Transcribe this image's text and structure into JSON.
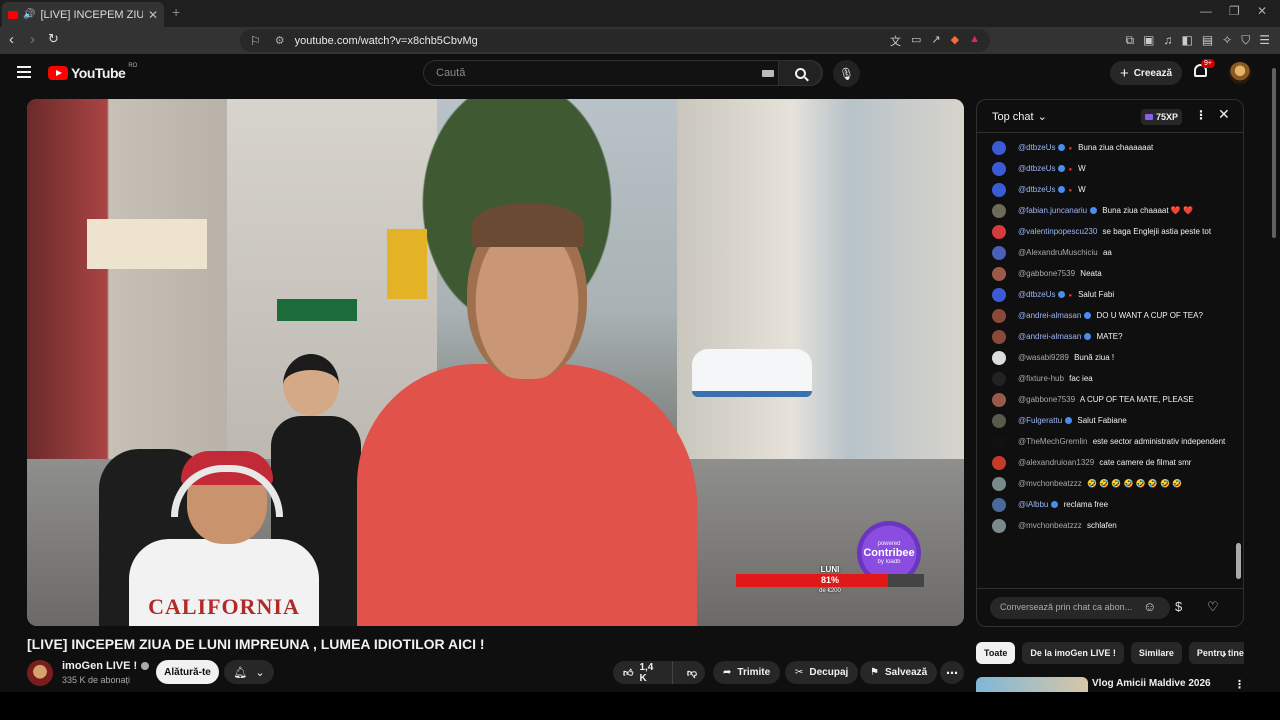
{
  "browser": {
    "tab_title": "[LIVE] INCEPEM ZIUA DE LUNI",
    "tab_close": "✕",
    "new_tab": "+",
    "url": "youtube.com/watch?v=x8chb5CbvMg"
  },
  "youtube": {
    "logo_text": "YouTube",
    "country": "RO",
    "search_placeholder": "Caută",
    "create_label": "Creează",
    "notif_count": "9+"
  },
  "video": {
    "title": "[LIVE] INCEPEM ZIUA DE LUNI IMPREUNA , LUMEA IDIOTILOR AICI !",
    "overlay_shirt": "CALIFORNIA",
    "contribee_powered": "powered",
    "contribee_name": "Contribee",
    "contribee_by": "by Ioadb",
    "goal_label": "LUNI",
    "goal_percent": "81%",
    "goal_fraction": 0.81,
    "goal_amount": "de €200"
  },
  "channel": {
    "name": "imoGen LIVE !",
    "subscribers": "335 K de abonați",
    "join_label": "Alătură-te"
  },
  "actions": {
    "likes": "1,4 K",
    "share": "Trimite",
    "clip": "Decupaj",
    "save": "Salvează"
  },
  "chat": {
    "header": "Top chat",
    "xp": "75XP",
    "input_placeholder": "Conversează prin chat ca abon...",
    "messages": [
      {
        "author": "@dtbzeUs",
        "text": "Buna ziua chaaaaaat",
        "color": "#3b5bd6",
        "badge": true,
        "mod": true
      },
      {
        "author": "@dtbzeUs",
        "text": "W",
        "color": "#3b5bd6",
        "badge": true,
        "mod": true
      },
      {
        "author": "@dtbzeUs",
        "text": "W",
        "color": "#3b5bd6",
        "badge": true,
        "mod": true
      },
      {
        "author": "@fabian.juncanariu",
        "text": "Buna ziua chaaaat ❤️ ❤️",
        "color": "#6b6b58",
        "badge": true,
        "mod": false
      },
      {
        "author": "@valentinpopescu230",
        "text": "se baga Englejii astia peste tot",
        "color": "#d63b3b",
        "badge": false,
        "mod": false
      },
      {
        "author": "@AlexandruMuschiciu",
        "text": "aa",
        "color": "#4a5fb5",
        "badge": false,
        "mod": false,
        "plain": true
      },
      {
        "author": "@gabbone7539",
        "text": "Neata",
        "color": "#9a5a4a",
        "badge": false,
        "mod": false,
        "plain": true
      },
      {
        "author": "@dtbzeUs",
        "text": "Salut Fabi",
        "color": "#3b5bd6",
        "badge": true,
        "mod": true
      },
      {
        "author": "@andrei-almasan",
        "text": "DO U WANT A CUP OF TEA?",
        "color": "#8a4a3a",
        "badge": true,
        "mod": false
      },
      {
        "author": "@andrei-almasan",
        "text": "MATE?",
        "color": "#8a4a3a",
        "badge": true,
        "mod": false
      },
      {
        "author": "@wasabi9289",
        "text": "Bună ziua !",
        "color": "#dddddd",
        "badge": false,
        "mod": false,
        "plain": true
      },
      {
        "author": "@fixture-hub",
        "text": "fac iea",
        "color": "#222222",
        "badge": false,
        "mod": false,
        "plain": true
      },
      {
        "author": "@gabbone7539",
        "text": "A CUP OF TEA MATE, PLEASE",
        "color": "#9a5a4a",
        "badge": false,
        "mod": false,
        "plain": true
      },
      {
        "author": "@Fulgerattu",
        "text": "Salut Fabiane",
        "color": "#5a5a4a",
        "badge": true,
        "mod": false
      },
      {
        "author": "@TheMechGremlin",
        "text": "este sector administrativ independent",
        "color": "#111111",
        "badge": false,
        "mod": false,
        "plain": true
      },
      {
        "author": "@alexandruioan1329",
        "text": "cate camere de filmat smr",
        "color": "#c63a2a",
        "badge": false,
        "mod": false,
        "plain": true
      },
      {
        "author": "@mvchonbeatzzz",
        "text": "🤣 🤣 🤣 🤣 🤣 🤣 🤣 🤣",
        "color": "#7a8a8a",
        "badge": false,
        "mod": false,
        "plain": true
      },
      {
        "author": "@iAlbbu",
        "text": "reclama free",
        "color": "#4a6a9a",
        "badge": true,
        "mod": false
      },
      {
        "author": "@mvchonbeatzzz",
        "text": "schlafen",
        "color": "#7a8a8a",
        "badge": false,
        "mod": false,
        "plain": true
      }
    ]
  },
  "chips": [
    "Toate",
    "De la imoGen LIVE !",
    "Similare",
    "Pentru tine"
  ],
  "recommendation": {
    "title": "Vlog Amicii Maldive 2026"
  }
}
